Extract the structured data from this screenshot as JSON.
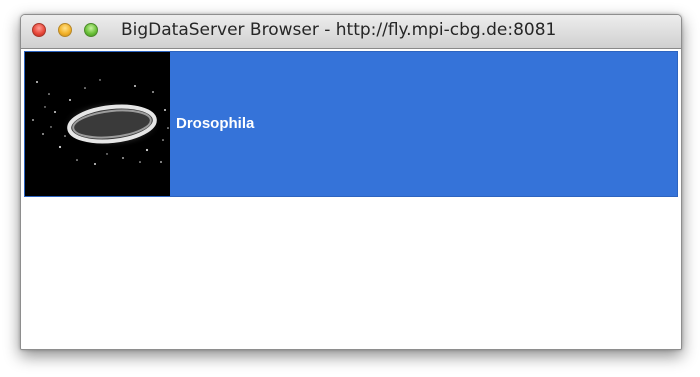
{
  "window": {
    "title": "BigDataServer Browser - http://fly.mpi-cbg.de:8081"
  },
  "datasets": [
    {
      "name": "Drosophila",
      "thumbnail_icon": "drosophila-embryo-thumbnail",
      "selected": true
    }
  ],
  "colors": {
    "selection": "#3573d9",
    "thumbnail_background": "#000000",
    "label_text": "#ffffff"
  }
}
